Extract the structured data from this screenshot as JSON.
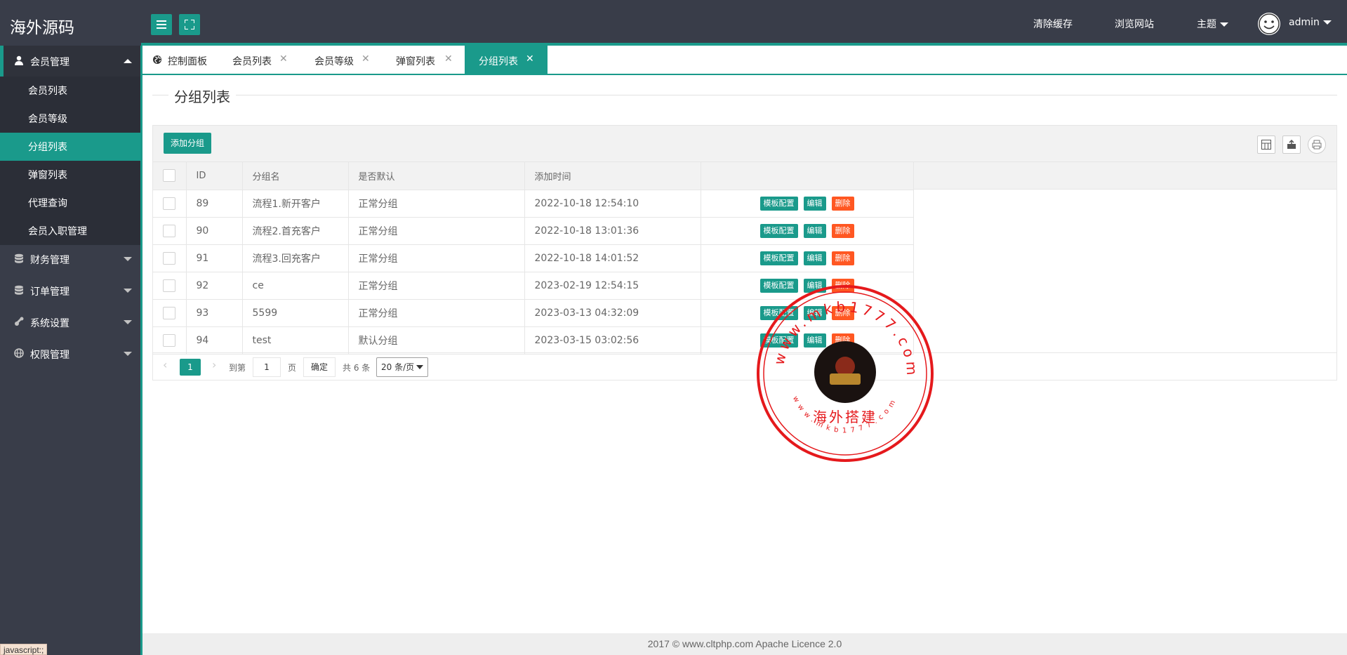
{
  "app": {
    "title": "海外源码"
  },
  "header": {
    "clear_cache": "清除缓存",
    "browse_site": "浏览网站",
    "theme": "主题",
    "user": "admin"
  },
  "sidebar": {
    "groups": [
      {
        "label": "会员管理",
        "icon": "user-icon",
        "expanded": true
      },
      {
        "label": "财务管理",
        "icon": "database-icon"
      },
      {
        "label": "订单管理",
        "icon": "database-icon"
      },
      {
        "label": "系统设置",
        "icon": "wrench-icon"
      },
      {
        "label": "权限管理",
        "icon": "globe-icon"
      }
    ],
    "sub_items": [
      "会员列表",
      "会员等级",
      "分组列表",
      "弹窗列表",
      "代理查询",
      "会员入职管理"
    ],
    "active_sub": "分组列表"
  },
  "status_tip": "javascript:;",
  "tabs": [
    {
      "label": "控制面板"
    },
    {
      "label": "会员列表"
    },
    {
      "label": "会员等级"
    },
    {
      "label": "弹窗列表"
    },
    {
      "label": "分组列表",
      "active": true
    }
  ],
  "page": {
    "title": "分组列表"
  },
  "toolbar": {
    "add_label": "添加分组"
  },
  "table": {
    "headers": [
      "ID",
      "分组名",
      "是否默认",
      "添加时间"
    ],
    "rows": [
      {
        "id": "89",
        "name": "流程1.新开客户",
        "default": "正常分组",
        "time": "2022-10-18 12:54:10"
      },
      {
        "id": "90",
        "name": "流程2.首充客户",
        "default": "正常分组",
        "time": "2022-10-18 13:01:36"
      },
      {
        "id": "91",
        "name": "流程3.回充客户",
        "default": "正常分组",
        "time": "2022-10-18 14:01:52"
      },
      {
        "id": "92",
        "name": "ce",
        "default": "正常分组",
        "time": "2023-02-19 12:54:15"
      },
      {
        "id": "93",
        "name": "5599",
        "default": "正常分组",
        "time": "2023-03-13 04:32:09"
      },
      {
        "id": "94",
        "name": "test",
        "default": "默认分组",
        "time": "2023-03-15 03:02:56"
      }
    ],
    "actions": {
      "template": "模板配置",
      "edit": "编辑",
      "delete": "删除"
    }
  },
  "pager": {
    "current": "1",
    "goto_label": "到第",
    "input_value": "1",
    "page_label": "页",
    "confirm": "确定",
    "total": "共 6 条",
    "per_page": "20 条/页"
  },
  "footer": {
    "text": "2017 ©  www.cltphp.com  Apache Licence 2.0"
  },
  "stamp": {
    "url_top": "www.mkb1777.com",
    "name": "海外搭建",
    "url_bottom": "www.mkb1777.com"
  },
  "colors": {
    "accent": "#1a9a8b",
    "danger": "#ff5722",
    "header": "#393d49",
    "stamp": "#e5191c"
  }
}
